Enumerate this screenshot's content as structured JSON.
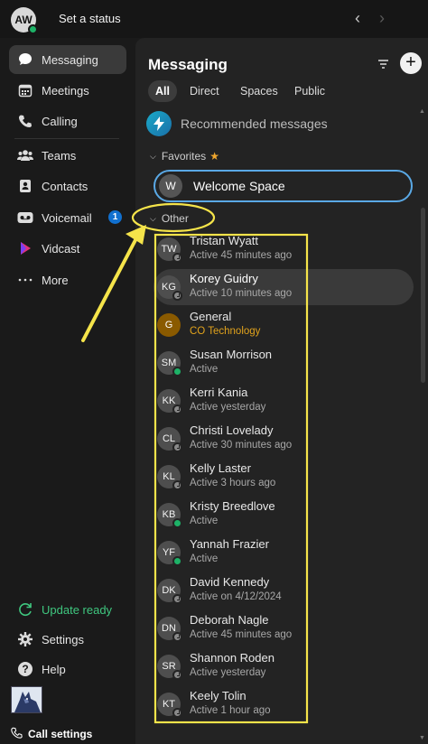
{
  "topbar": {
    "avatar_initials": "AW",
    "status_label": "Set a status"
  },
  "sidebar": {
    "items": [
      {
        "label": "Messaging",
        "icon": "chat-bubble-icon"
      },
      {
        "label": "Meetings",
        "icon": "calendar-icon"
      },
      {
        "label": "Calling",
        "icon": "phone-icon"
      },
      {
        "label": "Teams",
        "icon": "people-icon"
      },
      {
        "label": "Contacts",
        "icon": "contact-card-icon"
      },
      {
        "label": "Voicemail",
        "icon": "voicemail-icon",
        "badge": "1"
      },
      {
        "label": "Vidcast",
        "icon": "vidcast-icon"
      },
      {
        "label": "More",
        "icon": "more-dots-icon"
      }
    ],
    "footer": [
      {
        "label": "Update ready",
        "icon": "refresh-icon"
      },
      {
        "label": "Settings",
        "icon": "gear-icon"
      },
      {
        "label": "Help",
        "icon": "help-icon"
      }
    ],
    "call_settings": "Call settings"
  },
  "panel": {
    "title": "Messaging",
    "tabs": [
      "All",
      "Direct",
      "Spaces",
      "Public"
    ],
    "recommended": "Recommended messages",
    "favorites_label": "Favorites",
    "favorite": {
      "initial": "W",
      "name": "Welcome Space"
    },
    "other_label": "Other",
    "conversations": [
      {
        "initials": "TW",
        "name": "Tristan Wyatt",
        "sub": "Active 45 minutes ago",
        "presence": "away"
      },
      {
        "initials": "KG",
        "name": "Korey Guidry",
        "sub": "Active 10 minutes ago",
        "presence": "away"
      },
      {
        "initials": "G",
        "name": "General",
        "sub": "CO Technology",
        "presence": "none"
      },
      {
        "initials": "SM",
        "name": "Susan Morrison",
        "sub": "Active",
        "presence": "online"
      },
      {
        "initials": "KK",
        "name": "Kerri Kania",
        "sub": "Active yesterday",
        "presence": "away"
      },
      {
        "initials": "CL",
        "name": "Christi Lovelady",
        "sub": "Active 30 minutes ago",
        "presence": "away"
      },
      {
        "initials": "KL",
        "name": "Kelly  Laster",
        "sub": "Active 3 hours ago",
        "presence": "away"
      },
      {
        "initials": "KB",
        "name": "Kristy  Breedlove",
        "sub": "Active",
        "presence": "online"
      },
      {
        "initials": "YF",
        "name": "Yannah  Frazier",
        "sub": "Active",
        "presence": "online"
      },
      {
        "initials": "DK",
        "name": "David Kennedy",
        "sub": "Active on 4/12/2024",
        "presence": "away"
      },
      {
        "initials": "DN",
        "name": "Deborah Nagle",
        "sub": "Active 45 minutes ago",
        "presence": "away"
      },
      {
        "initials": "SR",
        "name": "Shannon Roden",
        "sub": "Active yesterday",
        "presence": "away"
      },
      {
        "initials": "KT",
        "name": "Keely  Tolin",
        "sub": "Active 1 hour ago",
        "presence": "away"
      }
    ]
  },
  "colors": {
    "accent": "#5aa9e6",
    "online": "#1db267",
    "annotation": "#f5e44a",
    "update": "#3fc77f"
  }
}
